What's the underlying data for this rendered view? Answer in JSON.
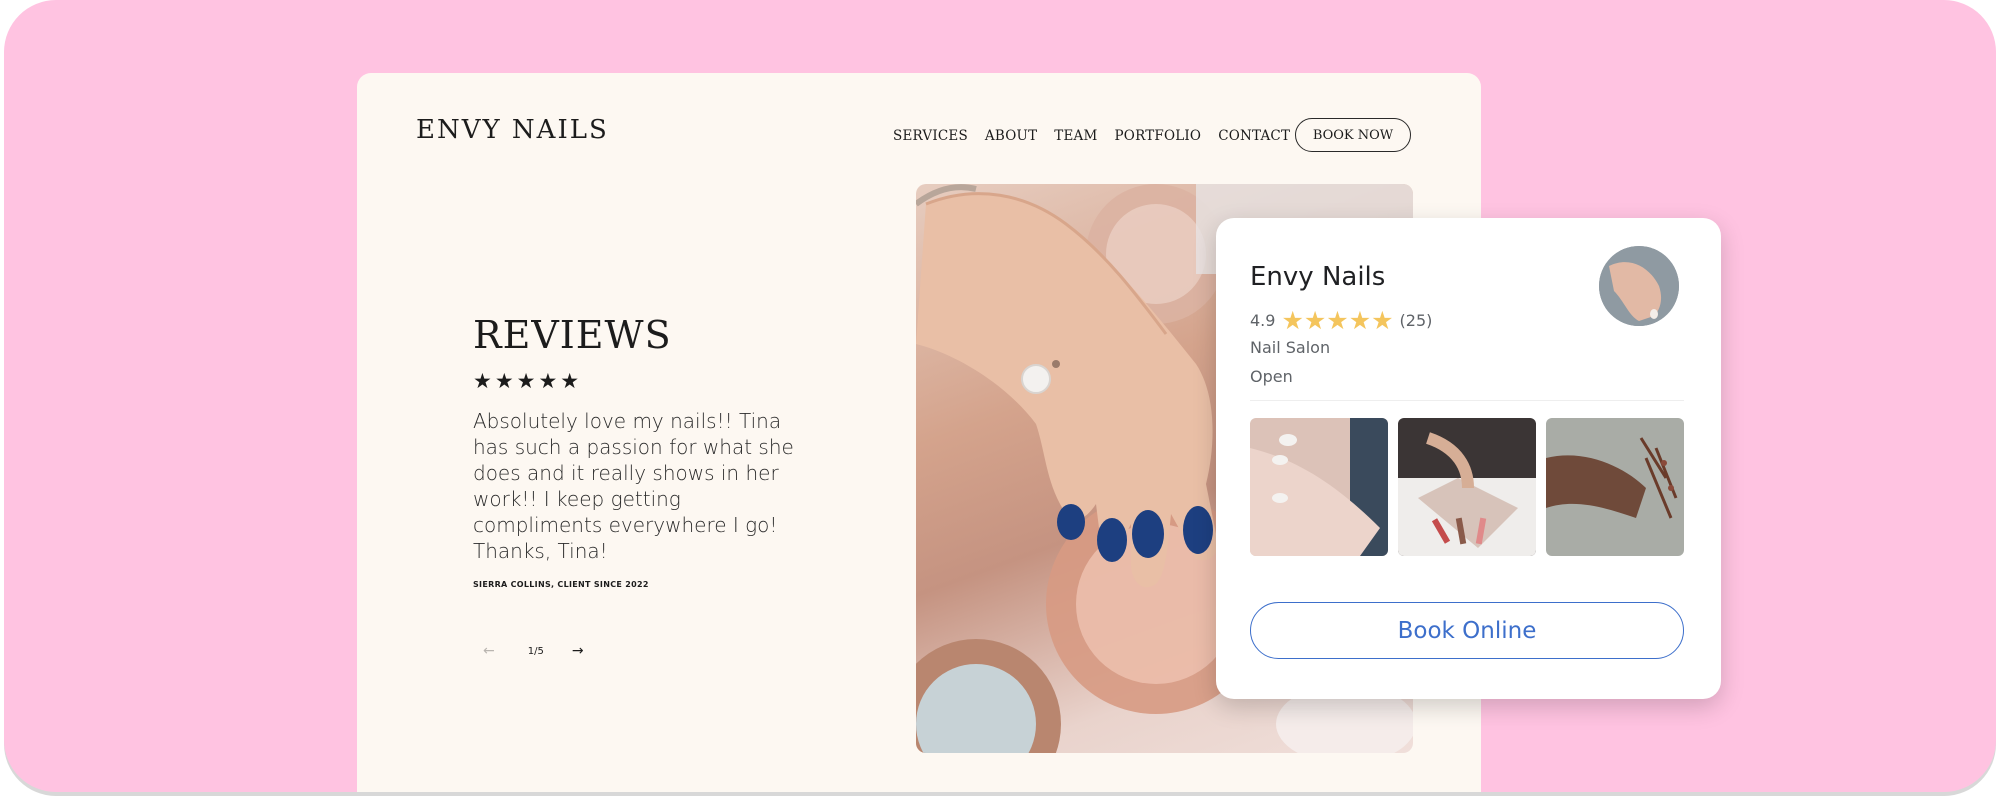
{
  "site": {
    "logo": "ENVY NAILS",
    "nav": [
      "SERVICES",
      "ABOUT",
      "TEAM",
      "PORTFOLIO",
      "CONTACT"
    ],
    "book_now_label": "BOOK NOW"
  },
  "reviews": {
    "title": "REVIEWS",
    "stars": "★★★★★",
    "text": "Absolutely love my nails!! Tina has such a passion for what she does and it really shows in her work!! I keep getting compliments everywhere I go! Thanks, Tina!",
    "reviewer": "SIERRA COLLINS, CLIENT SINCE 2022",
    "pagination": "1/5",
    "prev_arrow": "←",
    "next_arrow": "→"
  },
  "business_card": {
    "name": "Envy Nails",
    "rating": "4.9",
    "stars": "★★★★★",
    "review_count": "(25)",
    "category": "Nail Salon",
    "status": "Open",
    "cta_label": "Book Online"
  },
  "colors": {
    "background_pink": "#ffc3e1",
    "site_cream": "#fdf8f2",
    "star_gold": "#f4c55d",
    "cta_blue": "#3d6fcb",
    "nail_polish": "#1d3f80"
  }
}
